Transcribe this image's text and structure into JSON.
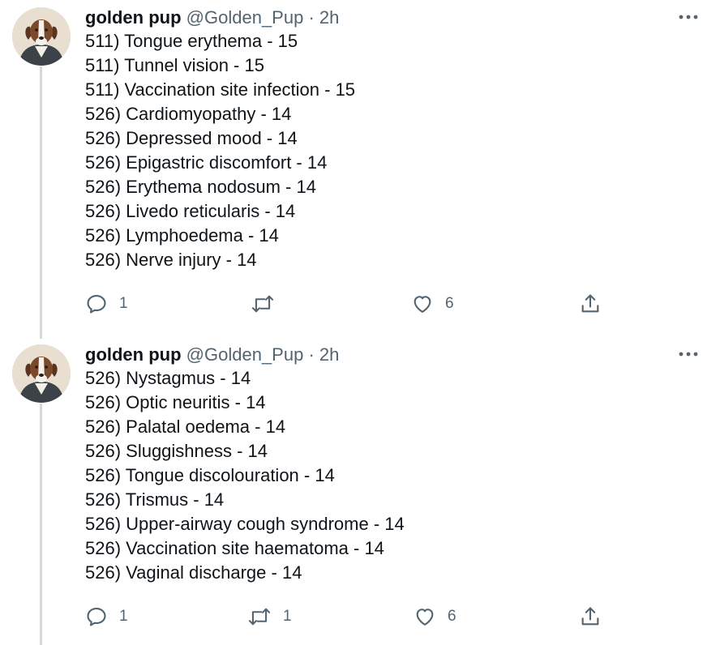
{
  "tweets": [
    {
      "author": {
        "name": "golden pup",
        "handle": "@Golden_Pup",
        "separator": "·",
        "time": "2h"
      },
      "lines": [
        "511) Tongue erythema - 15",
        "511) Tunnel vision - 15",
        "511) Vaccination site infection - 15",
        "526) Cardiomyopathy - 14",
        "526) Depressed mood - 14",
        "526) Epigastric discomfort - 14",
        "526) Erythema nodosum - 14",
        "526) Livedo reticularis - 14",
        "526) Lymphoedema - 14",
        "526) Nerve injury - 14"
      ],
      "actions": {
        "reply_count": "1",
        "retweet_count": "",
        "like_count": "6"
      }
    },
    {
      "author": {
        "name": "golden pup",
        "handle": "@Golden_Pup",
        "separator": "·",
        "time": "2h"
      },
      "lines": [
        "526) Nystagmus - 14",
        "526) Optic neuritis - 14",
        "526) Palatal oedema - 14",
        "526) Sluggishness - 14",
        "526) Tongue discolouration - 14",
        "526) Trismus - 14",
        "526) Upper-airway cough syndrome - 14",
        "526) Vaccination site haematoma - 14",
        "526) Vaginal discharge - 14"
      ],
      "actions": {
        "reply_count": "1",
        "retweet_count": "1",
        "like_count": "6"
      }
    }
  ],
  "icons": {
    "avatar": "dog-portrait-avatar",
    "more": "more-horizontal-icon",
    "reply": "reply-icon",
    "retweet": "retweet-icon",
    "like": "heart-icon",
    "share": "share-icon"
  },
  "colors": {
    "text": "#0f1419",
    "secondary": "#536471",
    "thread_line": "#cfd9de"
  }
}
